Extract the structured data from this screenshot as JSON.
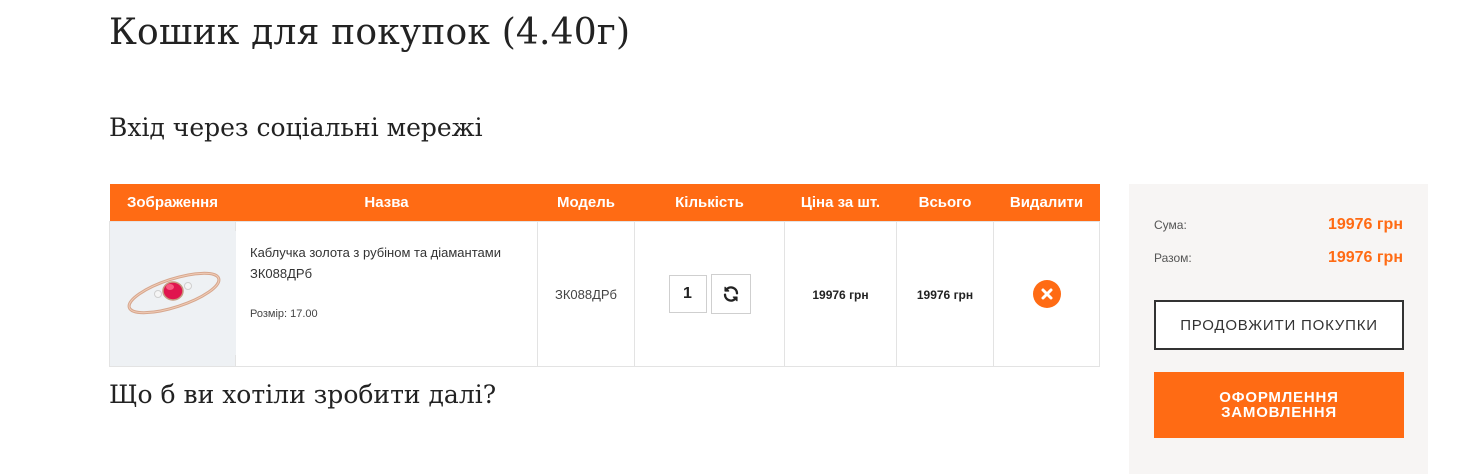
{
  "page": {
    "title": "Кошик для покупок  (4.40г)",
    "social_login_title": "Вхід через соціальні мережі",
    "next_title": "Що б ви хотіли зробити далі?"
  },
  "cart_table": {
    "headers": [
      "Зображення",
      "Назва",
      "Модель",
      "Кількість",
      "Ціна за шт.",
      "Всього",
      "Видалити"
    ],
    "items": [
      {
        "image_icon": "ruby-ring-image",
        "name": "Каблучка золота з рубіном та діамантами ЗК088ДРб",
        "size": "Розмір: 17.00",
        "model": "ЗК088ДРб",
        "quantity": "1",
        "unit_price": "19976 грн",
        "total": "19976 грн",
        "refresh_icon": "refresh-icon",
        "remove_icon": "remove-icon"
      }
    ]
  },
  "summary": {
    "subtotal_label": "Сума:",
    "subtotal_value": "19976 грн",
    "total_label": "Разом:",
    "total_value": "19976 грн",
    "continue_label": "ПРОДОВЖИТИ ПОКУПКИ",
    "checkout_label": "ОФОРМЛЕННЯ ЗАМОВЛЕННЯ"
  },
  "colors": {
    "accent": "#ff6b14",
    "summary_bg": "#f7f5f4",
    "text": "#222222"
  }
}
